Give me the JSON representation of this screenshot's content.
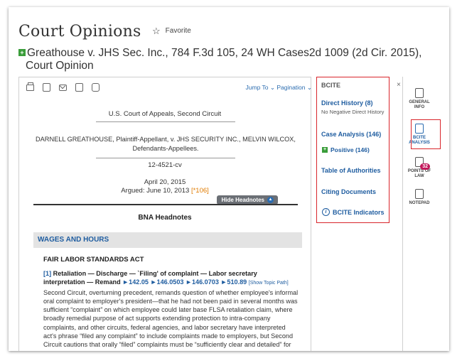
{
  "header": {
    "title": "Court Opinions",
    "favorite_label": "Favorite",
    "case_title_line1": "Greathouse v. JHS Sec. Inc., 784 F.3d 105, 24 WH Cases2d 1009 (2d Cir. 2015),",
    "case_title_line2": "Court Opinion"
  },
  "toolbar": {
    "icons": [
      "printer-icon",
      "download-icon",
      "email-icon",
      "document-icon",
      "lock-icon"
    ],
    "jump_to": "Jump To ⌄",
    "pagination": "Pagination ⌄"
  },
  "document": {
    "court": "U.S. Court of Appeals, Second Circuit",
    "parties": "DARNELL GREATHOUSE, Plaintiff-Appellant, v. JHS SECURITY INC., MELVIN WILCOX, Defendants-Appellees.",
    "docket": "12-4521-cv",
    "decided": "April 20, 2015",
    "argued_prefix": "Argued: June 10, 2013 ",
    "star_page": "[*106]",
    "hide_headnotes": "Hide Headnotes",
    "bna_heading": "BNA Headnotes",
    "section": "WAGES AND HOURS",
    "subsection": "FAIR LABOR STANDARDS ACT",
    "headnote": {
      "num": "[1]",
      "bold_text": "Retaliation — Discharge — `Filing' of complaint — Labor secretary interpretation — Remand ",
      "codes": "►142.05 ►146.0503 ►146.0703 ►510.89",
      "show_path": "[Show Topic Path]",
      "body": "Second Circuit, overturning precedent, remands question of whether employee's informal oral complaint to employer's president—that he had not been paid in several months was sufficient “complaint” on which employee could later base FLSA retaliation claim, where broadly remedial purpose of act supports extending protection to intra-company complaints, and other circuits, federal agencies, and labor secretary have interpreted act's phrase “filed any complaint” to include complaints made to employers, but Second Circuit cautions that orally “filed” complaints must be “sufficiently clear and detailed” for reasonable"
    }
  },
  "bcite": {
    "title": "BCITE",
    "close": "×",
    "direct_history": "Direct History (8)",
    "direct_history_sub": "No Negative Direct History",
    "case_analysis": "Case Analysis (146)",
    "positive": "Positive (146)",
    "table_of_authorities": "Table of Authorities",
    "citing_documents": "Citing Documents",
    "indicators": "BCITE Indicators"
  },
  "rail": {
    "general_info": "GENERAL INFO",
    "bcite_analysis": "BCITE ANALYSIS",
    "points_of_law": "POINTS OF LAW",
    "points_badge": "32",
    "notepad": "NOTEPAD"
  },
  "colors": {
    "accent_blue": "#1f5da0",
    "highlight_red": "#d9252b",
    "positive_green": "#3a9d3a",
    "star_orange": "#e07b00",
    "badge_pink": "#c2185b"
  }
}
